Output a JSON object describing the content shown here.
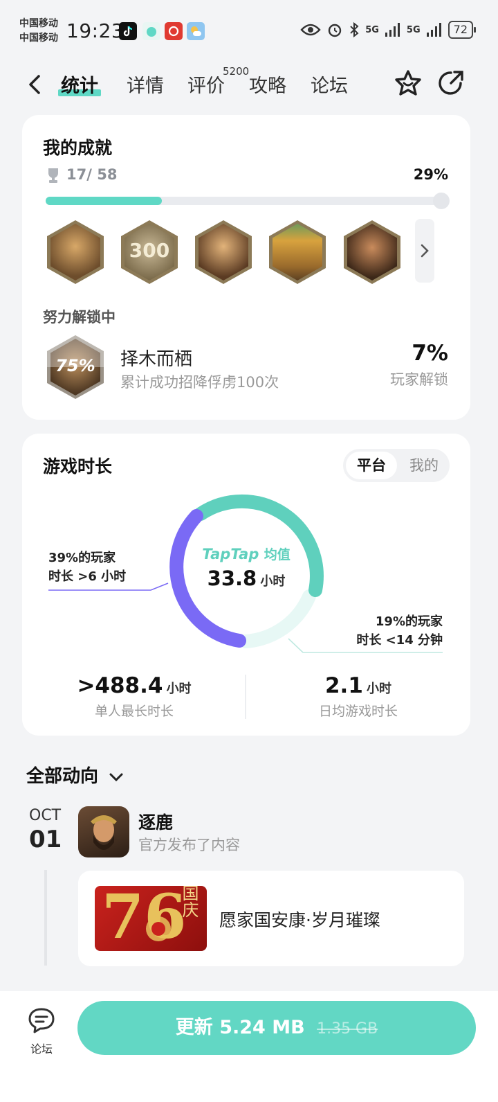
{
  "status_bar": {
    "carrier1": "中国移动",
    "carrier2": "中国移动",
    "time": "19:23",
    "network1": "5G",
    "network2": "5G",
    "battery": "72"
  },
  "nav": {
    "tabs": [
      {
        "label": "统计",
        "active": true
      },
      {
        "label": "详情"
      },
      {
        "label": "评价"
      },
      {
        "label": "攻略"
      },
      {
        "label": "论坛"
      }
    ],
    "review_count": "5200"
  },
  "achievements": {
    "title": "我的成就",
    "count": "17/ 58",
    "percent": "29%",
    "progress": 0.29,
    "badges": [
      {
        "name": "general-portrait-badge"
      },
      {
        "name": "300-badge",
        "text": "300"
      },
      {
        "name": "bearded-general-badge"
      },
      {
        "name": "palace-badge"
      },
      {
        "name": "warrior-badge"
      }
    ],
    "unlocking_title": "努力解锁中",
    "unlocking": {
      "badge_progress": "75%",
      "name": "择木而栖",
      "desc": "累计成功招降俘虏100次",
      "rate": "7%",
      "rate_label": "玩家解锁"
    }
  },
  "playtime": {
    "title": "游戏时长",
    "toggle_on": "平台",
    "toggle_off": "我的",
    "brand": "TapTap",
    "brand_suffix": "均值",
    "avg_value": "33.8",
    "avg_unit": "小时",
    "left_note_line1": "39%的玩家",
    "left_note_line2": "时长 >6 小时",
    "right_note_line1": "19%的玩家",
    "right_note_line2": "时长 <14 分钟",
    "max_value": ">488.4",
    "max_unit": "小时",
    "max_label": "单人最长时长",
    "daily_value": "2.1",
    "daily_unit": "小时",
    "daily_label": "日均游戏时长"
  },
  "feed": {
    "title": "全部动向",
    "month": "OCT",
    "day": "01",
    "author": "逐鹿",
    "action": "官方发布了内容",
    "post_text": "愿家国安康·岁月璀璨",
    "image_text_big": "76",
    "image_text_small": "国庆"
  },
  "bottom": {
    "forum_label": "论坛",
    "update_label": "更新 5.24 MB",
    "old_size": "1.35 GB"
  },
  "colors": {
    "accent": "#5fd8c5",
    "purple": "#7b6cf6",
    "light_teal": "#e6f8f5"
  }
}
